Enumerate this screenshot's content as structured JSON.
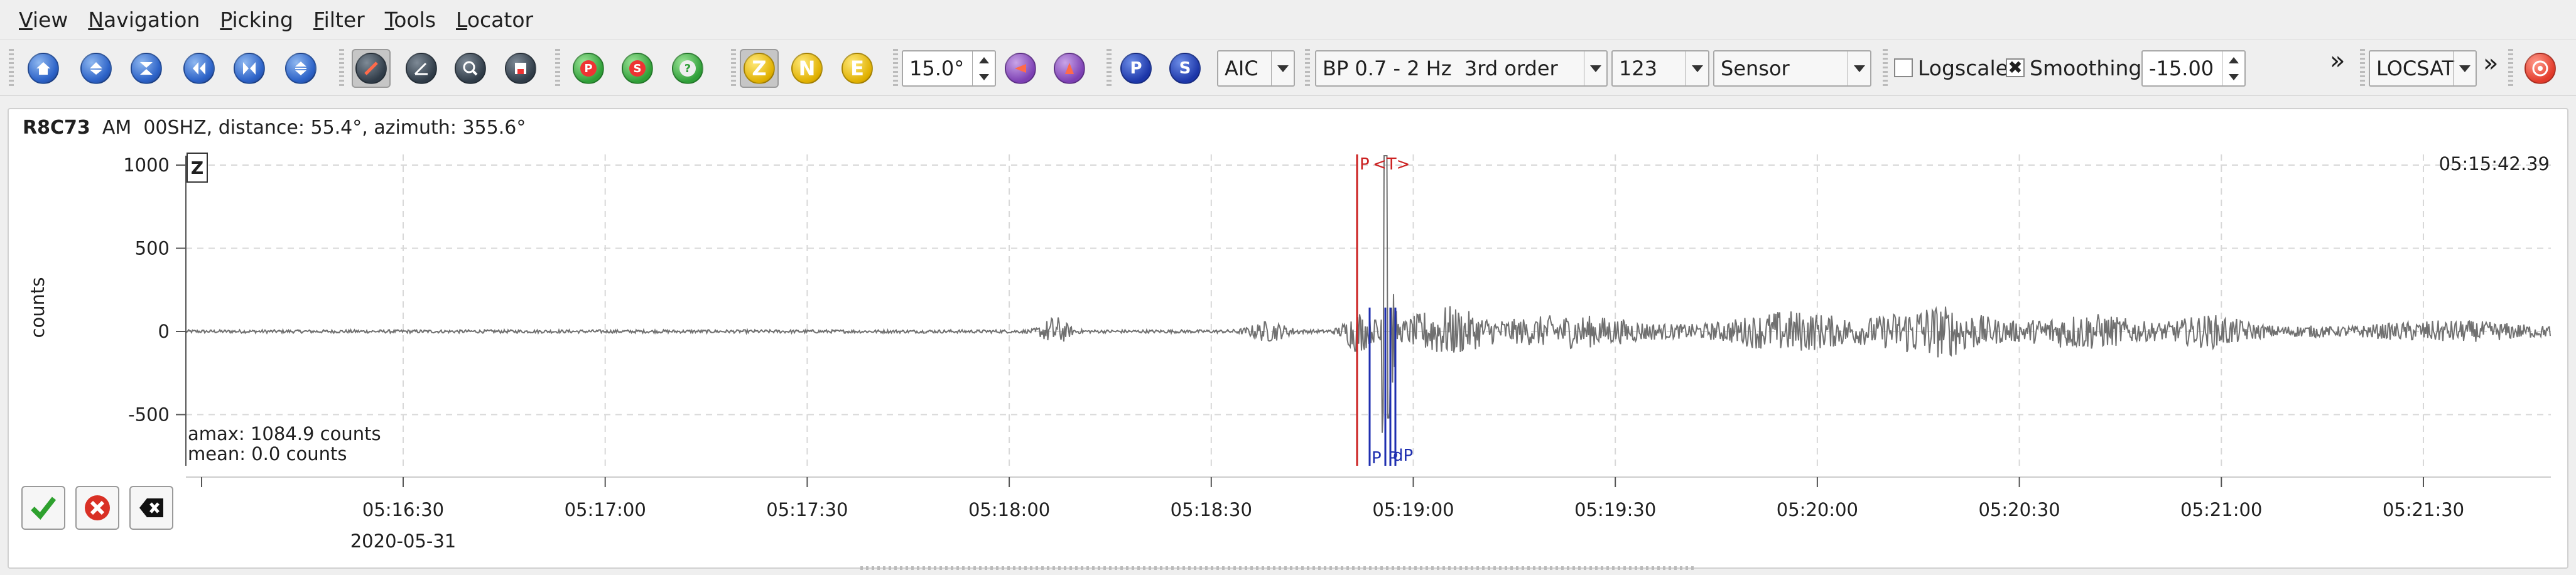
{
  "menu": [
    "View",
    "Navigation",
    "Picking",
    "Filter",
    "Tools",
    "Locator"
  ],
  "toolbar": {
    "nav_icons": [
      "home-icon",
      "scroll-up-icon",
      "zoom-in-vertical-icon",
      "step-left-icon",
      "fit-trace-icon",
      "zoom-out-vertical-icon"
    ],
    "align_icons": [
      "pick-mode-icon",
      "measure-icon",
      "spectrum-icon",
      "particle-motion-icon"
    ],
    "phase_icons": [
      "P",
      "S",
      "?"
    ],
    "components": [
      "Z",
      "N",
      "E"
    ],
    "distance_value": "15.0°",
    "pick_phases": [
      "P",
      "S"
    ],
    "picker": "AIC",
    "filter": "BP 0.7 - 2 Hz  3rd order",
    "channel": "123",
    "units": "Sensor",
    "logscale_label": "Logscale",
    "logscale_checked": false,
    "smoothing_label": "Smoothing",
    "smoothing_checked": true,
    "smoothing_value": "-15.00",
    "overflow": "»",
    "locator": "LOCSAT",
    "overflow2": "»"
  },
  "trace": {
    "station": "R8C73",
    "network": "AM",
    "channel": "00SHZ",
    "info": ", distance: 55.4°, azimuth: 355.6°",
    "component_box": "Z",
    "ylabel": "counts",
    "end_time": "05:15:42.39",
    "amax": "amax: 1084.9 counts",
    "mean": "mean: 0.0 counts",
    "y_ticks": [
      {
        "label": "1000",
        "value": 1000
      },
      {
        "label": "500",
        "value": 500
      },
      {
        "label": "0",
        "value": 0
      },
      {
        "label": "-500",
        "value": -500
      }
    ],
    "x_ticks": [
      "05:16:30",
      "05:17:00",
      "05:17:30",
      "05:18:00",
      "05:18:30",
      "05:19:00",
      "05:19:30",
      "05:20:00",
      "05:20:30",
      "05:21:00",
      "05:21:30"
    ],
    "date": "2020-05-31",
    "pick_label": "P",
    "theo_label": "<T>",
    "blue_labels": [
      "P",
      "P",
      "dP"
    ]
  },
  "buttons": [
    "accept-icon",
    "reject-icon",
    "clear-icon"
  ],
  "colors": {
    "pick": "#cc2222",
    "theoretical": "#1f2fb0",
    "trace": "#707070",
    "grid": "#d8d8d8"
  }
}
